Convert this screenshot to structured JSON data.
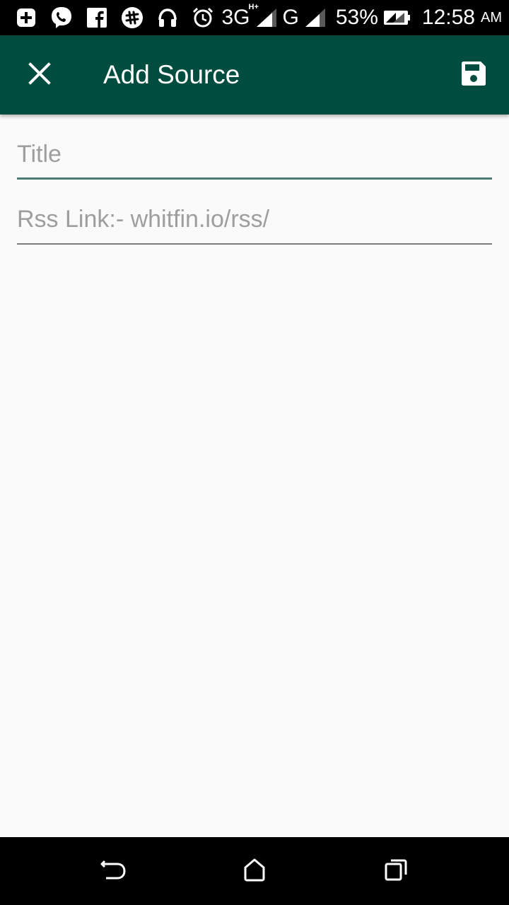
{
  "status_bar": {
    "network_3g": "3G",
    "network_3g_sup": "H+",
    "network_g": "G",
    "battery_percent": "53%",
    "time": "12:58",
    "ampm": "AM",
    "icons": [
      "add-box-icon",
      "viber-icon",
      "facebook-icon",
      "slack-icon",
      "headset-icon",
      "alarm-icon",
      "signal-icon",
      "signal-icon",
      "battery-icon"
    ]
  },
  "app_bar": {
    "title": "Add Source",
    "background_color": "#004d40",
    "close_icon": "close-icon",
    "save_icon": "save-icon"
  },
  "form": {
    "title_field": {
      "placeholder": "Title",
      "value": ""
    },
    "rss_field": {
      "placeholder": "Rss Link:- whitfin.io/rss/",
      "value": ""
    }
  },
  "nav_bar": {
    "icons": [
      "back-icon",
      "home-icon",
      "recents-icon"
    ]
  }
}
